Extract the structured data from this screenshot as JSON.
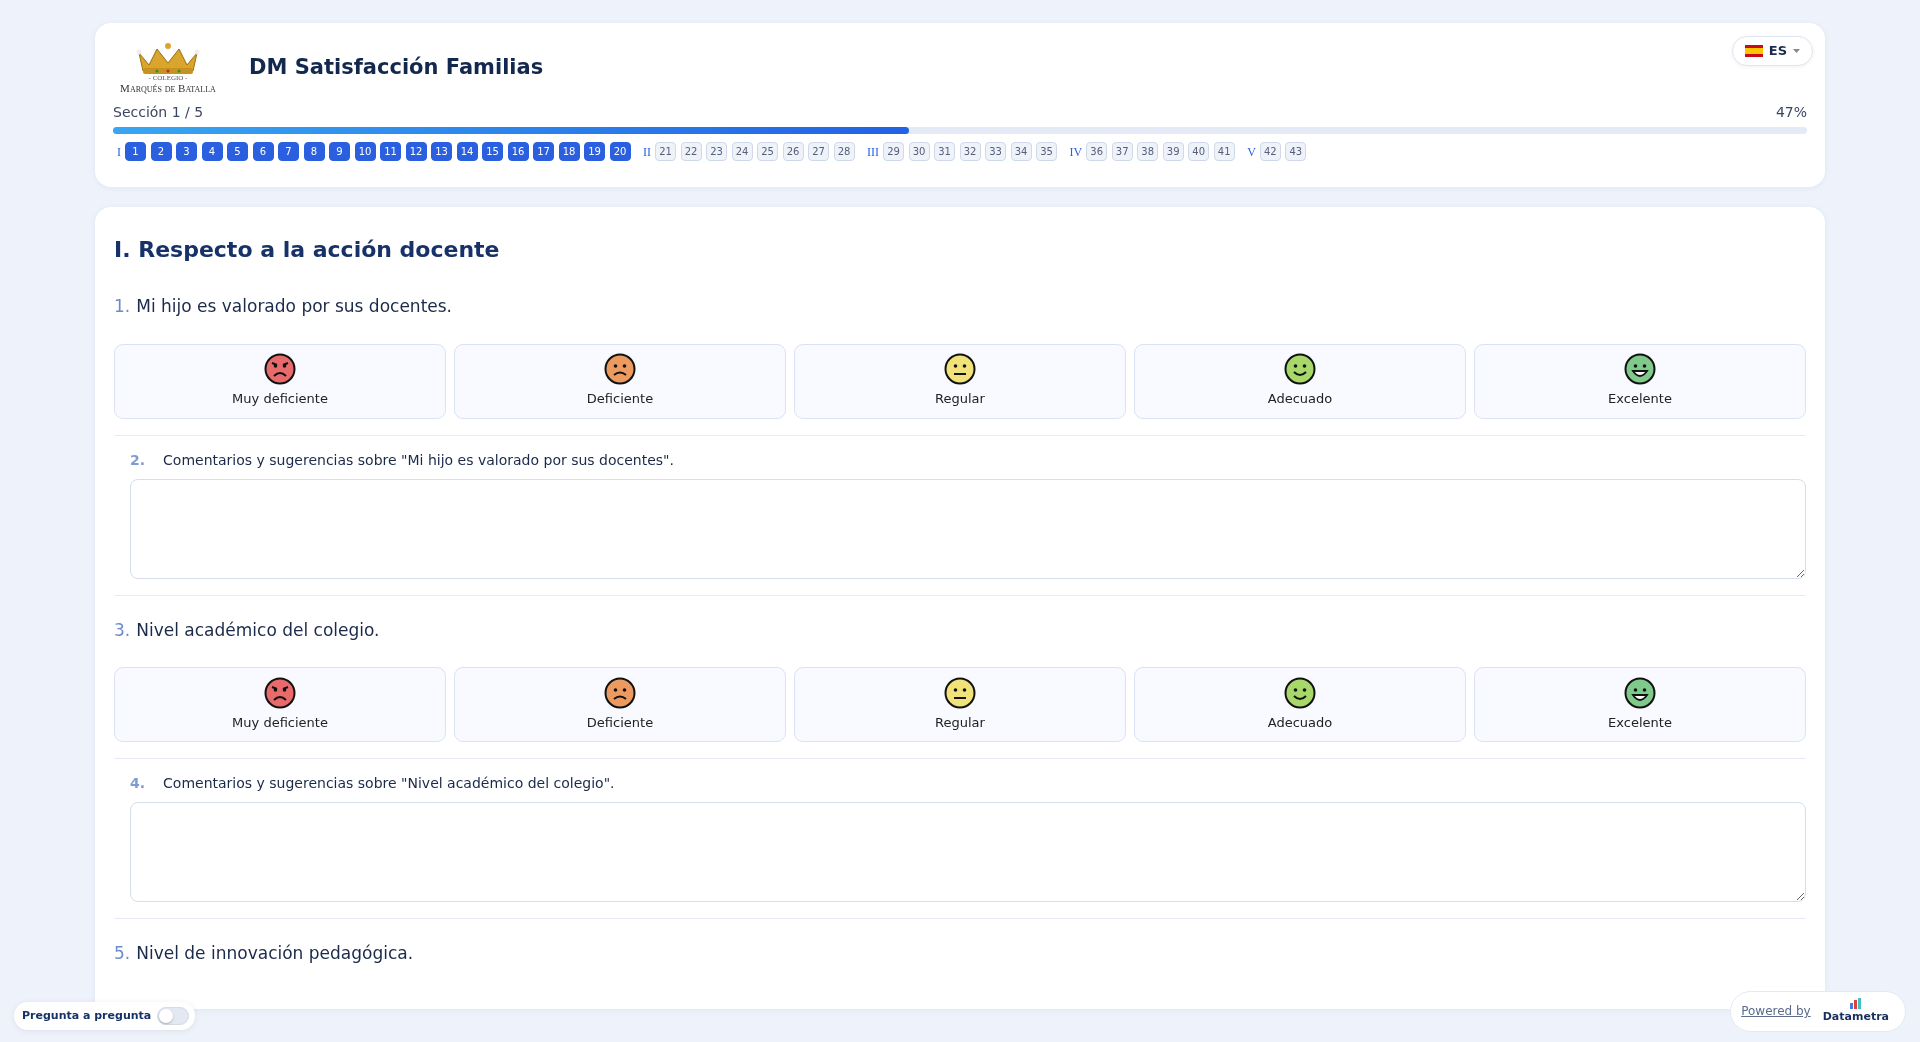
{
  "header": {
    "logo": {
      "small_text": "- COLEGIO -",
      "name": "Marqués de Batalla"
    },
    "title": "DM Satisfacción Familias",
    "language": {
      "code": "ES"
    },
    "section_label": "Sección 1 / 5",
    "percent": "47%",
    "progress": {
      "level": 0.47
    }
  },
  "nav_sections": [
    {
      "label": "I",
      "questions": [
        {
          "number": "1",
          "active": true
        },
        {
          "number": "2",
          "active": true
        },
        {
          "number": "3",
          "active": true
        },
        {
          "number": "4",
          "active": true
        },
        {
          "number": "5",
          "active": true
        },
        {
          "number": "6",
          "active": true
        },
        {
          "number": "7",
          "active": true
        },
        {
          "number": "8",
          "active": true
        },
        {
          "number": "9",
          "active": true
        },
        {
          "number": "10",
          "active": true
        },
        {
          "number": "11",
          "active": true
        },
        {
          "number": "12",
          "active": true
        },
        {
          "number": "13",
          "active": true
        },
        {
          "number": "14",
          "active": true
        },
        {
          "number": "15",
          "active": true
        },
        {
          "number": "16",
          "active": true
        },
        {
          "number": "17",
          "active": true
        },
        {
          "number": "18",
          "active": true
        },
        {
          "number": "19",
          "active": true
        },
        {
          "number": "20",
          "active": true
        }
      ]
    },
    {
      "label": "II",
      "questions": [
        {
          "number": "21",
          "active": false
        },
        {
          "number": "22",
          "active": false
        },
        {
          "number": "23",
          "active": false
        },
        {
          "number": "24",
          "active": false
        },
        {
          "number": "25",
          "active": false
        },
        {
          "number": "26",
          "active": false
        },
        {
          "number": "27",
          "active": false
        },
        {
          "number": "28",
          "active": false
        }
      ]
    },
    {
      "label": "III",
      "questions": [
        {
          "number": "29",
          "active": false
        },
        {
          "number": "30",
          "active": false
        },
        {
          "number": "31",
          "active": false
        },
        {
          "number": "32",
          "active": false
        },
        {
          "number": "33",
          "active": false
        },
        {
          "number": "34",
          "active": false
        },
        {
          "number": "35",
          "active": false
        }
      ]
    },
    {
      "label": "IV",
      "questions": [
        {
          "number": "36",
          "active": false
        },
        {
          "number": "37",
          "active": false
        },
        {
          "number": "38",
          "active": false
        },
        {
          "number": "39",
          "active": false
        },
        {
          "number": "40",
          "active": false
        },
        {
          "number": "41",
          "active": false
        }
      ]
    },
    {
      "label": "V",
      "questions": [
        {
          "number": "42",
          "active": false
        },
        {
          "number": "43",
          "active": false
        }
      ]
    }
  ],
  "section_title": "I. Respecto a la acción docente",
  "questions": [
    {
      "kind": "rating",
      "number": "1.",
      "text": "Mi hijo es valorado por sus docentes.",
      "options": [
        {
          "label": "Muy deficiente",
          "kind": "angry",
          "color": "#e86a6a",
          "selected": false
        },
        {
          "label": "Deficiente",
          "kind": "sad",
          "color": "#ec9a60",
          "selected": false
        },
        {
          "label": "Regular",
          "kind": "neutral",
          "color": "#f2e27a",
          "selected": false
        },
        {
          "label": "Adecuado",
          "kind": "smile",
          "color": "#a8d86a",
          "selected": false
        },
        {
          "label": "Excelente",
          "kind": "grin",
          "color": "#7fc98a",
          "selected": false
        }
      ]
    },
    {
      "kind": "comment",
      "number": "2.",
      "text": "Comentarios y sugerencias sobre \"Mi hijo es valorado por sus docentes\"."
    },
    {
      "kind": "rating",
      "number": "3.",
      "text": "Nivel académico del colegio.",
      "options": [
        {
          "label": "Muy deficiente",
          "kind": "angry",
          "color": "#e86a6a",
          "selected": false
        },
        {
          "label": "Deficiente",
          "kind": "sad",
          "color": "#ec9a60",
          "selected": false
        },
        {
          "label": "Regular",
          "kind": "neutral",
          "color": "#f2e27a",
          "selected": false
        },
        {
          "label": "Adecuado",
          "kind": "smile",
          "color": "#a8d86a",
          "selected": false
        },
        {
          "label": "Excelente",
          "kind": "grin",
          "color": "#7fc98a",
          "selected": false
        }
      ]
    },
    {
      "kind": "comment",
      "number": "4.",
      "text": "Comentarios y sugerencias sobre \"Nivel académico del colegio\"."
    },
    {
      "kind": "rating",
      "number": "5.",
      "text": "Nivel de innovación pedagógica."
    }
  ],
  "question_mode_toggle": {
    "label": "Pregunta a pregunta",
    "on": false
  },
  "powered_by": {
    "label": "Powered by",
    "brand": "Datametra"
  }
}
